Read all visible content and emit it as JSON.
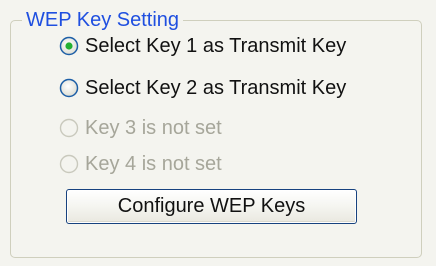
{
  "group": {
    "title": "WEP Key Setting"
  },
  "radios": [
    {
      "label": "Select Key 1 as Transmit Key",
      "selected": true,
      "enabled": true
    },
    {
      "label": "Select Key 2 as Transmit Key",
      "selected": false,
      "enabled": true
    },
    {
      "label": "Key 3 is not set",
      "selected": false,
      "enabled": false
    },
    {
      "label": "Key 4 is not set",
      "selected": false,
      "enabled": false
    }
  ],
  "button": {
    "label": "Configure WEP Keys"
  },
  "colors": {
    "background": "#f4f4ef",
    "group_title": "#1f4fe0",
    "disabled_text": "#a6a69a",
    "button_border": "#17427f"
  }
}
